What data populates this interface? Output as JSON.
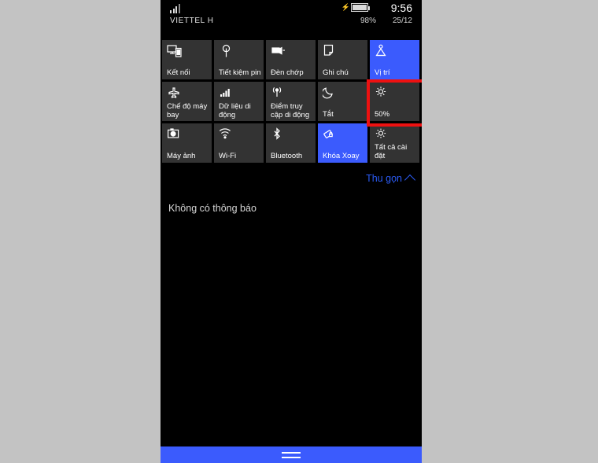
{
  "statusbar": {
    "carrier": "VIETTEL H",
    "time": "9:56",
    "battery_percent": "98%",
    "date": "25/12",
    "signal_icon": "signal-bars-icon",
    "battery_icon": "battery-charging-icon"
  },
  "tiles": {
    "rows": [
      [
        {
          "label": "Kết nối",
          "icon": "connect-devices-icon",
          "active": false
        },
        {
          "label": "Tiết kiệm pin",
          "icon": "leaf-battery-saver-icon",
          "active": false
        },
        {
          "label": "Đèn chớp",
          "icon": "flashlight-icon",
          "active": false
        },
        {
          "label": "Ghi chú",
          "icon": "note-page-icon",
          "active": false
        },
        {
          "label": "Vị trí",
          "icon": "location-pin-icon",
          "active": true
        }
      ],
      [
        {
          "label": "Chế độ máy bay",
          "icon": "airplane-icon",
          "active": false
        },
        {
          "label": "Dữ liệu di động",
          "icon": "cellular-signal-icon",
          "active": false
        },
        {
          "label": "Điểm truy cập di động",
          "icon": "mobile-hotspot-icon",
          "active": false
        },
        {
          "label": "Tắt",
          "icon": "moon-quiet-hours-icon",
          "active": false
        },
        {
          "label": "50%",
          "icon": "brightness-sun-icon",
          "active": false
        }
      ],
      [
        {
          "label": "Máy ảnh",
          "icon": "camera-icon",
          "active": false
        },
        {
          "label": "Wi-Fi",
          "icon": "wifi-icon",
          "active": false
        },
        {
          "label": "Bluetooth",
          "icon": "bluetooth-icon",
          "active": false
        },
        {
          "label": "Khóa Xoay",
          "icon": "rotation-lock-icon",
          "active": true
        },
        {
          "label": "Tất cả cài đặt",
          "icon": "gear-settings-icon",
          "active": false
        }
      ]
    ]
  },
  "collapse": {
    "label": "Thu gọn"
  },
  "notifications": {
    "empty_text": "Không có thông báo"
  },
  "highlight": {
    "color": "#ee1111",
    "target_tile_label": "Tất cả cài đặt"
  },
  "navbar": {
    "handle_icon": "nav-handle-icon",
    "color": "#3b5bfd"
  },
  "colors": {
    "page_background": "#c3c3c3",
    "screen_background": "#000000",
    "tile_inactive": "#333333",
    "tile_active": "#3b5bfd",
    "link_blue": "#2b5bf5"
  }
}
